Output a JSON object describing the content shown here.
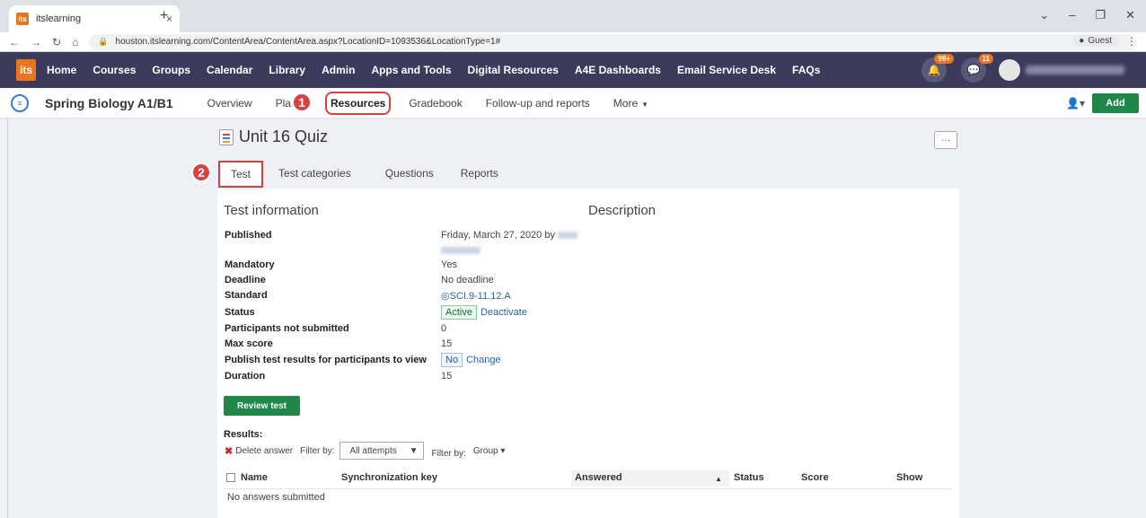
{
  "browser": {
    "tab_title": "itslearning",
    "tab_favicon": "its",
    "close_glyph": "×",
    "newtab_glyph": "+",
    "url": "houston.itslearning.com/ContentArea/ContentArea.aspx?LocationID=1093536&LocationType=1#",
    "profile_label": "Guest"
  },
  "topnav": {
    "logo": "its",
    "items": [
      "Home",
      "Courses",
      "Groups",
      "Calendar",
      "Library",
      "Admin",
      "Apps and Tools",
      "Digital Resources",
      "A4E Dashboards",
      "Email Service Desk",
      "FAQs"
    ],
    "notifications_badge": "99+",
    "messages_badge": "11"
  },
  "course": {
    "title": "Spring Biology A1/B1",
    "tabs": [
      "Overview",
      "Pla",
      "Resources",
      "Gradebook",
      "Follow-up and reports",
      "More"
    ],
    "add_label": "Add",
    "step1": "1",
    "step2": "2"
  },
  "quiz": {
    "title": "Unit 16 Quiz",
    "more_label": "···",
    "subtabs": [
      "Test",
      "Test categories",
      "Questions",
      "Reports"
    ]
  },
  "info": {
    "heading": "Test information",
    "description_heading": "Description",
    "published_label": "Published",
    "published_value": "Friday, March 27, 2020 by",
    "mandatory_label": "Mandatory",
    "mandatory_value": "Yes",
    "deadline_label": "Deadline",
    "deadline_value": "No deadline",
    "standard_label": "Standard",
    "standard_value": "SCI.9-11.12.A",
    "status_label": "Status",
    "status_value": "Active",
    "status_action": "Deactivate",
    "not_submitted_label": "Participants not submitted",
    "not_submitted_value": "0",
    "max_score_label": "Max score",
    "max_score_value": "15",
    "publish_results_label": "Publish test results for participants to view",
    "publish_results_value": "No",
    "publish_results_action": "Change",
    "duration_label": "Duration",
    "duration_value": "15",
    "review_button": "Review test"
  },
  "results": {
    "heading": "Results:",
    "delete_label": "Delete answer",
    "filter_label": "Filter by:",
    "attempts_value": "All attempts",
    "filter_label2": "Filter by:",
    "group_label": "Group",
    "columns": [
      "Name",
      "Synchronization key",
      "Answered",
      "Status",
      "Score",
      "Show"
    ],
    "empty_text": "No answers submitted"
  }
}
